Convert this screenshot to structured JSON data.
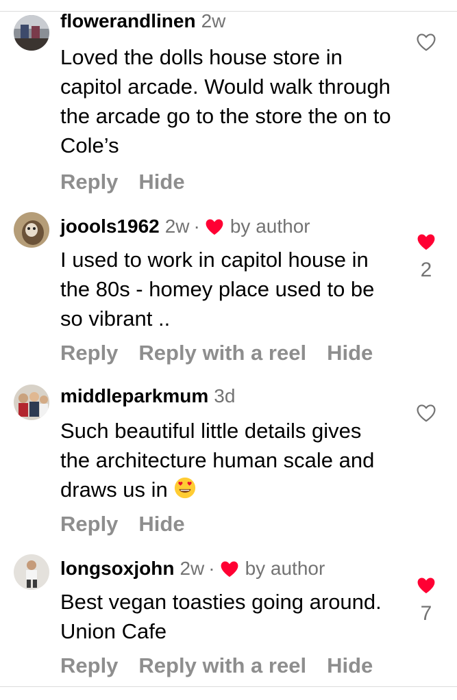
{
  "comments": [
    {
      "username": "flowerandlinen",
      "time": "2w",
      "text": "Loved the dolls house store in capitol arcade. Would walk through the arcade go to the store the on to Cole’s",
      "author_liked": false,
      "like_count": "",
      "actions": [
        "Reply",
        "Hide"
      ]
    },
    {
      "username": "joools1962",
      "time": "2w",
      "author_label": "by author",
      "text": "I used to work in capitol house in the 80s - homey place used to be so vibrant ..",
      "author_liked": true,
      "like_count": "2",
      "actions": [
        "Reply",
        "Reply with a reel",
        "Hide"
      ]
    },
    {
      "username": "middleparkmum",
      "time": "3d",
      "text": "Such beautiful little details gives the architecture human scale and draws us in",
      "author_liked": false,
      "like_count": "",
      "actions": [
        "Reply",
        "Hide"
      ]
    },
    {
      "username": "longsoxjohn",
      "time": "2w",
      "author_label": "by author",
      "text": "Best vegan toasties going around. Union Cafe",
      "author_liked": true,
      "like_count": "7",
      "actions": [
        "Reply",
        "Reply with a reel",
        "Hide"
      ]
    }
  ],
  "icons": {
    "heart_outline": "heart-outline-icon",
    "heart_filled": "heart-filled-icon",
    "emoji": "heart-eyes-emoji"
  },
  "colors": {
    "like_red": "#ff0033",
    "secondary_text": "#737373",
    "action_text": "#8e8e8e"
  }
}
